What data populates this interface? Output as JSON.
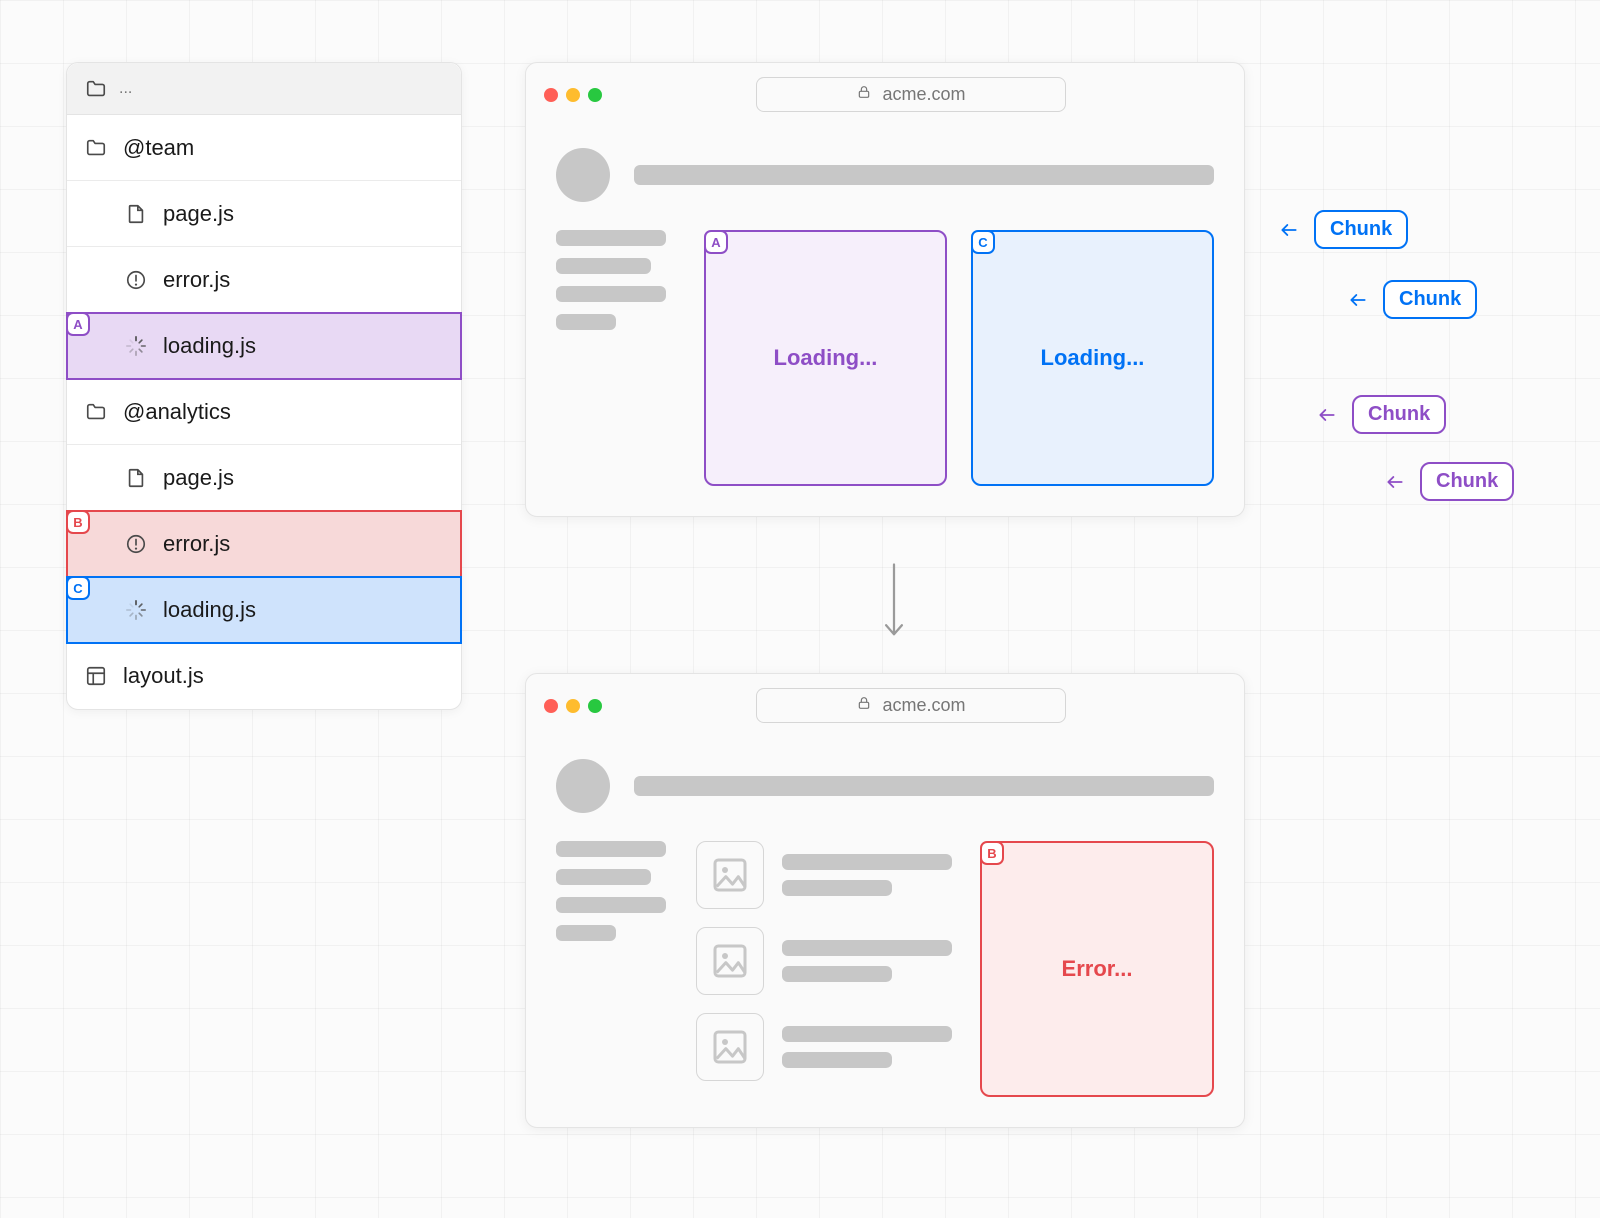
{
  "file_tree": {
    "breadcrumb": "...",
    "items": [
      {
        "label": "@team",
        "depth": 0,
        "icon": "folder",
        "tag": null,
        "highlight": null
      },
      {
        "label": "page.js",
        "depth": 1,
        "icon": "file",
        "tag": null,
        "highlight": null
      },
      {
        "label": "error.js",
        "depth": 1,
        "icon": "error",
        "tag": null,
        "highlight": null
      },
      {
        "label": "loading.js",
        "depth": 1,
        "icon": "spinner",
        "tag": "A",
        "highlight": "purple"
      },
      {
        "label": "@analytics",
        "depth": 0,
        "icon": "folder",
        "tag": null,
        "highlight": null
      },
      {
        "label": "page.js",
        "depth": 1,
        "icon": "file",
        "tag": null,
        "highlight": null
      },
      {
        "label": "error.js",
        "depth": 1,
        "icon": "error",
        "tag": "B",
        "highlight": "red"
      },
      {
        "label": "loading.js",
        "depth": 1,
        "icon": "spinner",
        "tag": "C",
        "highlight": "blue"
      },
      {
        "label": "layout.js",
        "depth": 0,
        "icon": "layout",
        "tag": null,
        "highlight": null
      }
    ]
  },
  "browser_top": {
    "url": "acme.com",
    "slots": [
      {
        "tag": "A",
        "color": "purple",
        "label": "Loading..."
      },
      {
        "tag": "C",
        "color": "blue",
        "label": "Loading..."
      }
    ]
  },
  "browser_bottom": {
    "url": "acme.com",
    "error_slot": {
      "tag": "B",
      "color": "red",
      "label": "Error..."
    }
  },
  "chunks": [
    {
      "color": "blue",
      "label": "Chunk"
    },
    {
      "color": "blue",
      "label": "Chunk"
    },
    {
      "color": "purple",
      "label": "Chunk"
    },
    {
      "color": "purple",
      "label": "Chunk"
    }
  ]
}
